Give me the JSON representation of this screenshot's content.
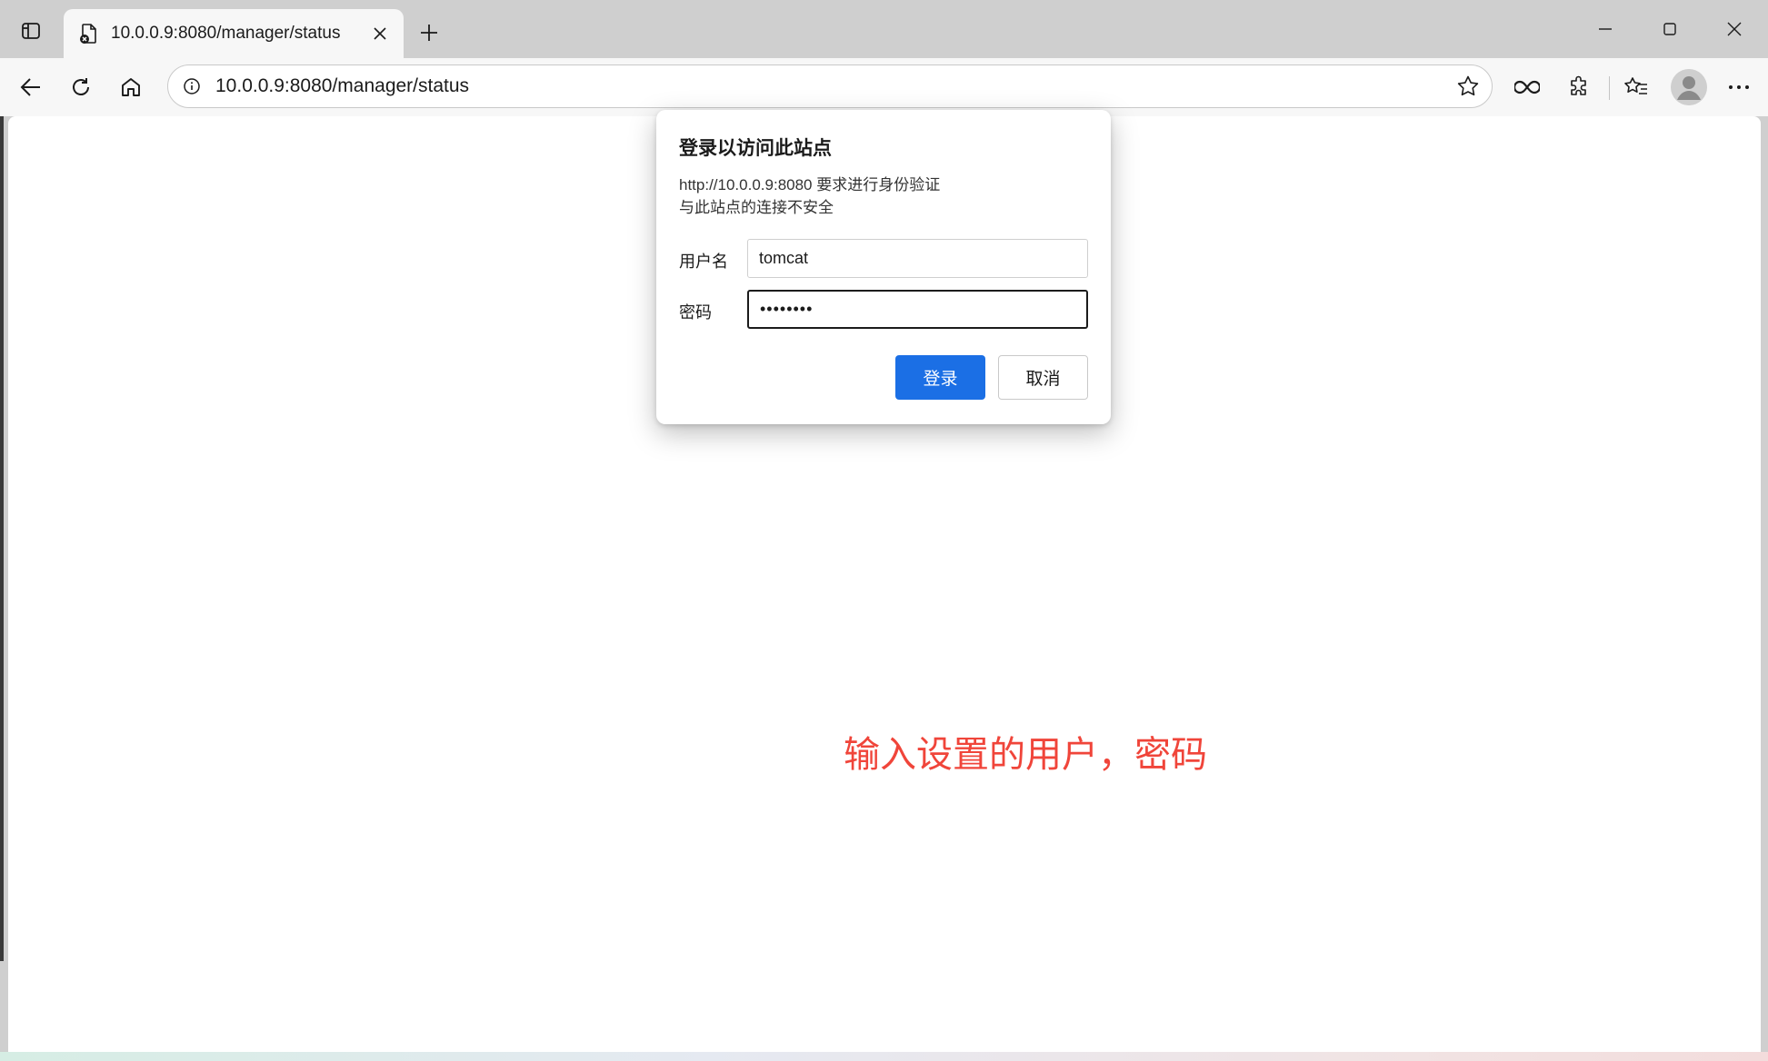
{
  "browser": {
    "tab": {
      "title": "10.0.0.9:8080/manager/status"
    },
    "address_bar": {
      "url": "10.0.0.9:8080/manager/status"
    },
    "icons": {
      "tab_actions": "tab-actions-icon",
      "favicon": "page-error-icon",
      "close_tab": "close-icon",
      "new_tab": "plus-icon",
      "back": "back-arrow-icon",
      "refresh": "refresh-icon",
      "home": "home-icon",
      "site_info": "info-icon",
      "favorite": "star-icon",
      "extensions": "puzzle-icon",
      "favorites": "favorites-icon",
      "more": "more-icon"
    }
  },
  "auth_dialog": {
    "title": "登录以访问此站点",
    "message_line1": "http://10.0.0.9:8080 要求进行身份验证",
    "message_line2": "与此站点的连接不安全",
    "username_label": "用户名",
    "username_value": "tomcat",
    "password_label": "密码",
    "password_mask": "••••••••",
    "login_button": "登录",
    "cancel_button": "取消"
  },
  "annotation": {
    "text": "输入设置的用户，密码",
    "color": "#f0453a"
  },
  "colors": {
    "primary": "#1b6fe5"
  }
}
